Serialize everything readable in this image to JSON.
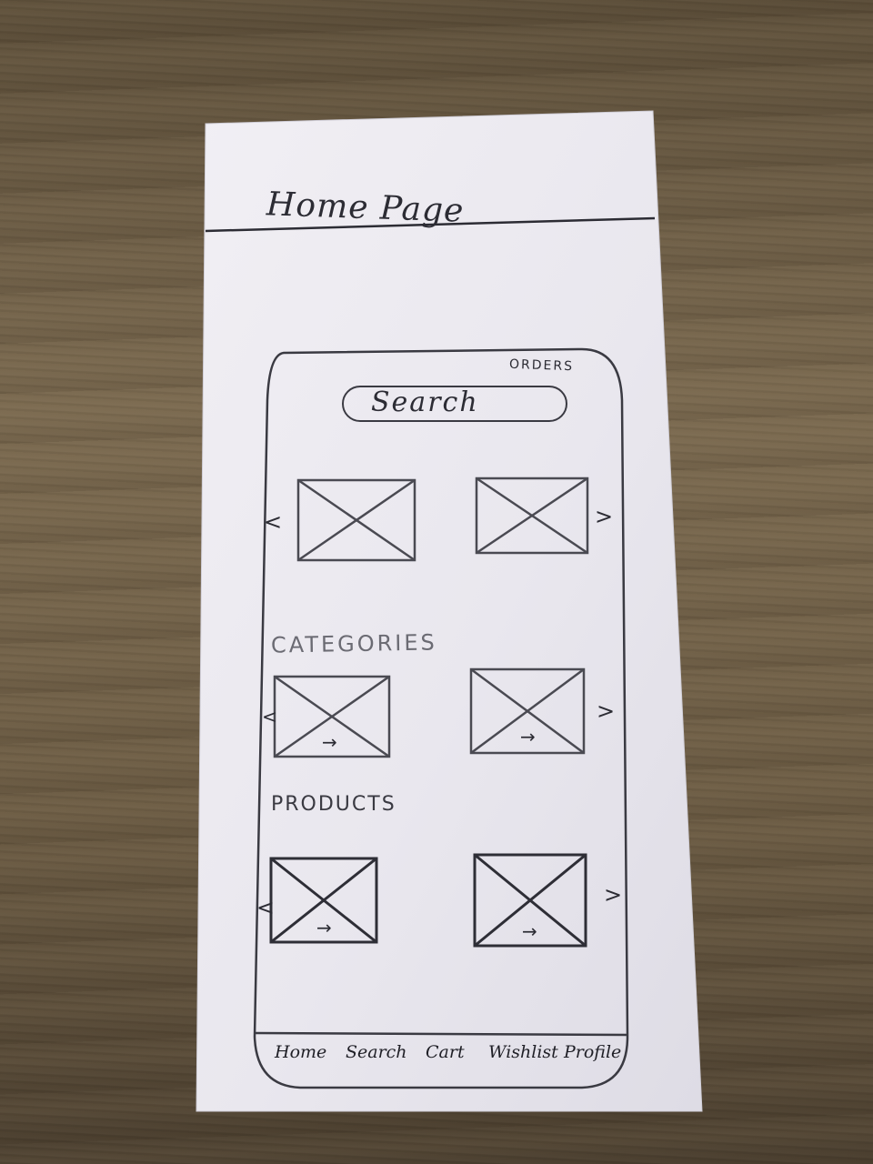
{
  "page": {
    "title": "Home Page"
  },
  "header": {
    "orders_label": "ORDERS",
    "search_placeholder": "Search"
  },
  "carousel": {
    "prev_label": "<",
    "next_label": ">"
  },
  "categories": {
    "heading": "CATEGORIES",
    "prev_label": "<",
    "next_label": ">",
    "item_arrow": "→"
  },
  "products": {
    "heading": "PRODUCTS",
    "prev_label": "<",
    "next_label": ">",
    "item_arrow": "→"
  },
  "bottom_nav": {
    "items": [
      {
        "label": "Home"
      },
      {
        "label": "Search"
      },
      {
        "label": "Cart"
      },
      {
        "label": "Wishlist"
      },
      {
        "label": "Profile"
      }
    ]
  },
  "colors": {
    "paper": "#eceaf0",
    "ink": "#2c2c34",
    "table": "#6f6048"
  }
}
